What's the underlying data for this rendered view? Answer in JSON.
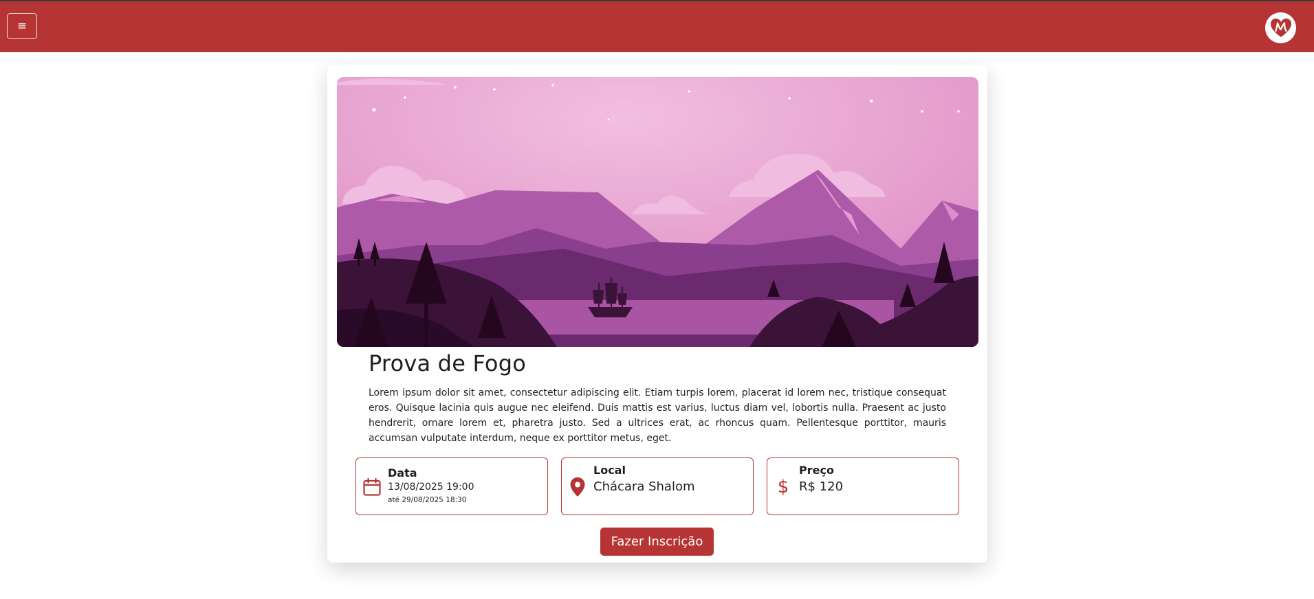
{
  "navbar": {
    "menu_icon": "hamburger-icon",
    "menu_glyph": "≡",
    "logo_icon": "heart-m-logo",
    "brand_color": "#b63434"
  },
  "event": {
    "title": "Prova de Fogo",
    "description": "Lorem ipsum dolor sit amet, consectetur adipiscing elit. Etiam turpis lorem, placerat id lorem nec, tristique consequat eros. Quisque lacinia quis augue nec eleifend. Duis mattis est varius, luctus diam vel, lobortis nulla. Praesent ac justo hendrerit, ornare lorem et, pharetra justo. Sed a ultrices erat, ac rhoncus quam. Pellentesque porttitor, mauris accumsan vulputate interdum, neque ex porttitor metus, eget."
  },
  "info": {
    "date": {
      "label": "Data",
      "value": "13/08/2025 19:00",
      "end": "até 29/08/2025 18:30",
      "icon": "calendar-icon"
    },
    "location": {
      "label": "Local",
      "value": "Chácara Shalom",
      "icon": "map-pin-icon"
    },
    "price": {
      "label": "Preço",
      "value": "R$ 120",
      "icon": "dollar-icon",
      "glyph": "$"
    }
  },
  "cta": {
    "label": "Fazer Inscrição"
  }
}
